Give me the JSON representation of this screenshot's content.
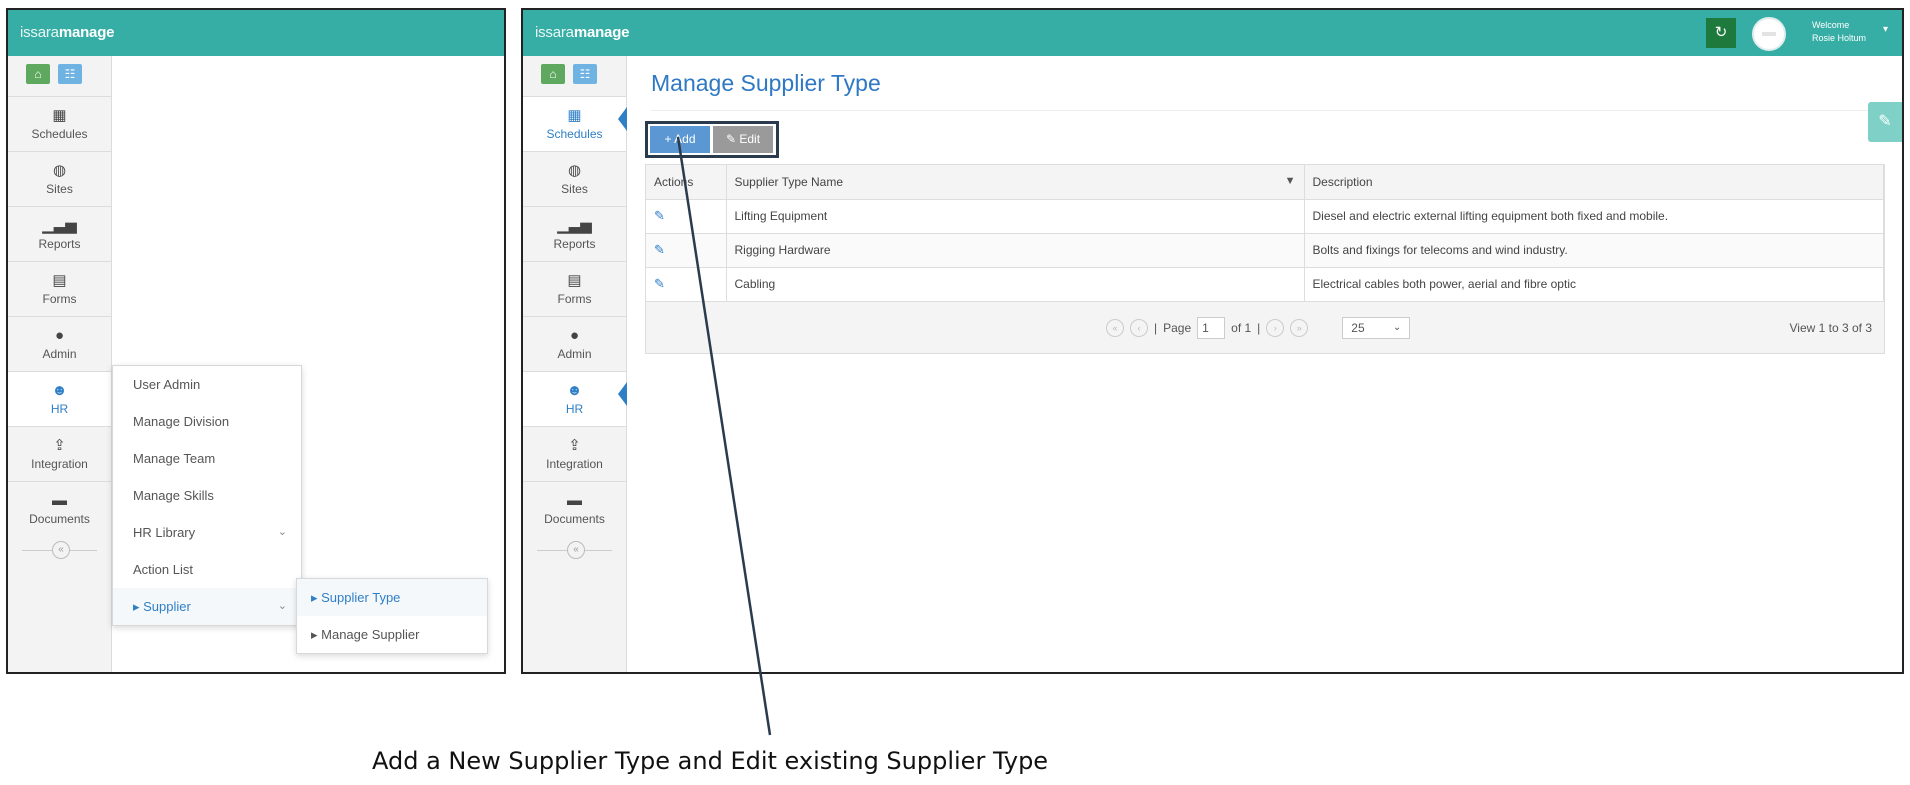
{
  "left_panel": {
    "logo": {
      "light": "issara",
      "bold": "manage"
    },
    "rail_items": [
      {
        "label": "Schedules",
        "icon": "calendar-icon"
      },
      {
        "label": "Sites",
        "icon": "globe-icon"
      },
      {
        "label": "Reports",
        "icon": "bar-chart-icon"
      },
      {
        "label": "Forms",
        "icon": "document-icon"
      },
      {
        "label": "Admin",
        "icon": "user-icon"
      },
      {
        "label": "HR",
        "icon": "group-icon"
      },
      {
        "label": "Integration",
        "icon": "upload-icon"
      },
      {
        "label": "Documents",
        "icon": "folder-icon"
      }
    ],
    "hr_menu": [
      "User Admin",
      "Manage Division",
      "Manage Team",
      "Manage Skills",
      "HR Library",
      "Action List",
      "Supplier"
    ],
    "supplier_submenu": [
      "Supplier Type",
      "Manage Supplier"
    ]
  },
  "right_panel": {
    "logo": {
      "light": "issara",
      "bold": "manage"
    },
    "user": {
      "welcome": "Welcome",
      "name": "Rosie Holtum"
    },
    "rail_items": [
      {
        "label": "Schedules"
      },
      {
        "label": "Sites"
      },
      {
        "label": "Reports"
      },
      {
        "label": "Forms"
      },
      {
        "label": "Admin"
      },
      {
        "label": "HR"
      },
      {
        "label": "Integration"
      },
      {
        "label": "Documents"
      }
    ],
    "page_title": "Manage Supplier Type",
    "toolbar": {
      "add_label": "+ Add",
      "edit_label": "Edit"
    },
    "table": {
      "columns": [
        "Actions",
        "Supplier Type Name",
        "Description"
      ],
      "rows": [
        {
          "name": "Lifting Equipment",
          "description": "Diesel and electric external lifting equipment both fixed and mobile."
        },
        {
          "name": "Rigging Hardware",
          "description": "Bolts and fixings for telecoms and wind industry."
        },
        {
          "name": "Cabling",
          "description": "Electrical cables both power, aerial and fibre optic"
        }
      ]
    },
    "pager": {
      "page_label": "Page",
      "page": "1",
      "of_label": "of 1",
      "per_page": "25",
      "summary": "View 1 to 3 of 3"
    }
  },
  "caption": "Add a New Supplier Type and Edit existing Supplier Type"
}
